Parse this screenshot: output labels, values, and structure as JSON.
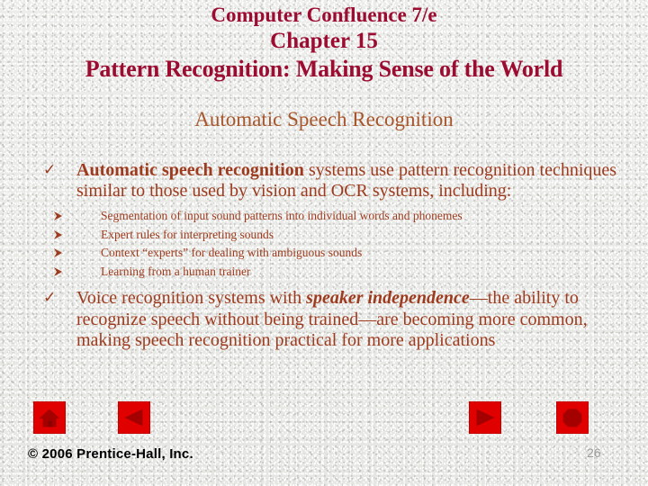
{
  "slide": {
    "background_color": "#e9e9e7",
    "title_color": "#9c0c31",
    "subtitle_color": "#a8562c",
    "body_color": "#9e3b1e",
    "button_color": "#e00000"
  },
  "title": {
    "line1": "Computer Confluence 7/e",
    "line2": "Chapter 15",
    "line3": "Pattern Recognition: Making Sense of the World"
  },
  "subtitle": "Automatic Speech Recognition",
  "bullets": {
    "b1": {
      "marker": "checkmark",
      "bold_lead": "Automatic speech recognition",
      "rest": " systems use pattern recognition techniques similar to those used by vision and OCR systems, including:"
    },
    "sub": [
      {
        "marker": "arrow-bullet",
        "text": "Segmentation of input sound patterns into individual words and phonemes"
      },
      {
        "marker": "arrow-bullet",
        "text": "Expert rules for interpreting sounds"
      },
      {
        "marker": "arrow-bullet",
        "text": "Context “experts” for dealing with ambiguous sounds"
      },
      {
        "marker": "arrow-bullet",
        "text": "Learning from a human trainer"
      }
    ],
    "b2": {
      "marker": "checkmark",
      "part1": "Voice recognition systems with ",
      "emphasis": "speaker independence",
      "part2": "—the ability to recognize speech without being trained—are becoming more common, making speech recognition practical for more applications"
    }
  },
  "nav": {
    "home": {
      "label": "Home",
      "icon": "home-icon"
    },
    "previous": {
      "label": "Previous",
      "icon": "triangle-left-icon"
    },
    "next": {
      "label": "Next",
      "icon": "triangle-right-icon"
    },
    "end": {
      "label": "End",
      "icon": "octagon-icon"
    }
  },
  "footer": {
    "copyright": "© 2006 Prentice-Hall, Inc.",
    "page_number": "26"
  }
}
